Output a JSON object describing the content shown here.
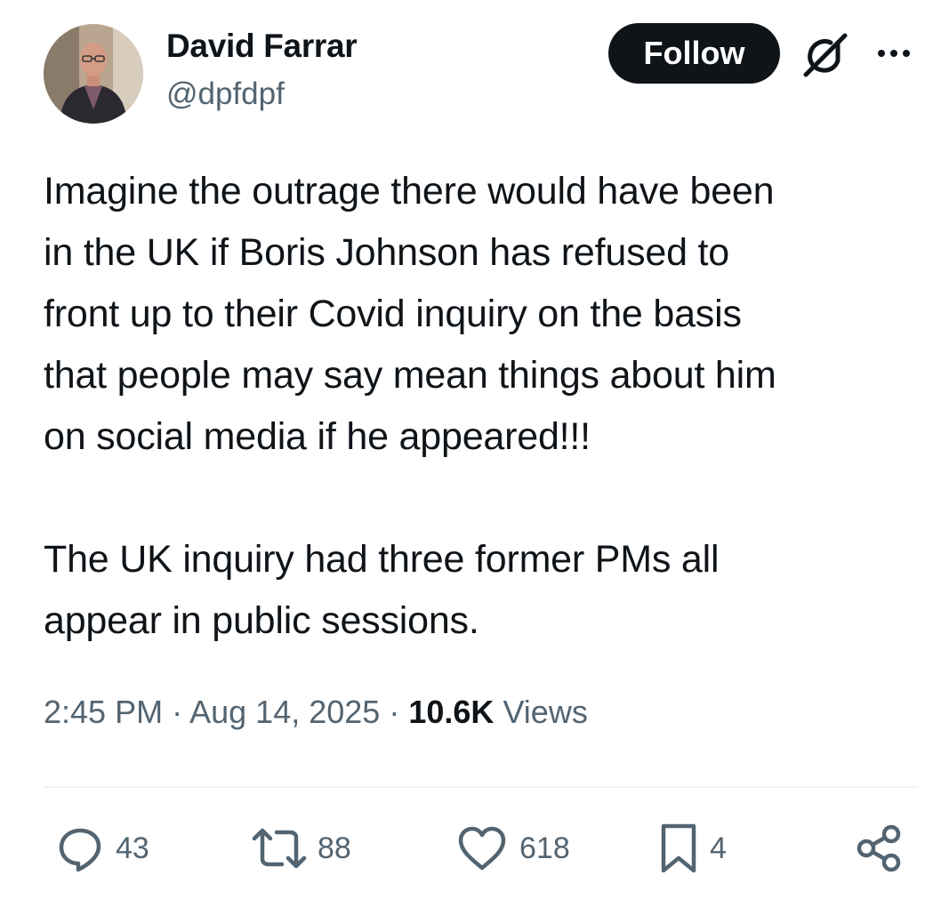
{
  "user": {
    "display_name": "David Farrar",
    "handle": "@dpfdpf"
  },
  "header": {
    "follow_label": "Follow",
    "grok_icon": "grok-icon",
    "more_icon": "more-icon"
  },
  "tweet": {
    "paragraphs": [
      "Imagine the outrage there would have been\nin the UK if Boris Johnson has refused to\nfront up to their Covid inquiry on the basis\nthat people may say mean things about him\non social media if he appeared!!!",
      "The UK inquiry had three former PMs all\nappear in public sessions."
    ]
  },
  "meta": {
    "time": "2:45 PM",
    "separator": "·",
    "date": "Aug 14, 2025",
    "views_count": "10.6K",
    "views_label": "Views"
  },
  "actions": {
    "replies": "43",
    "reposts": "88",
    "likes": "618",
    "bookmarks": "4"
  },
  "colors": {
    "text": "#0f1419",
    "secondary": "#536471",
    "divider": "#eff3f4",
    "button_bg": "#0f1419"
  }
}
